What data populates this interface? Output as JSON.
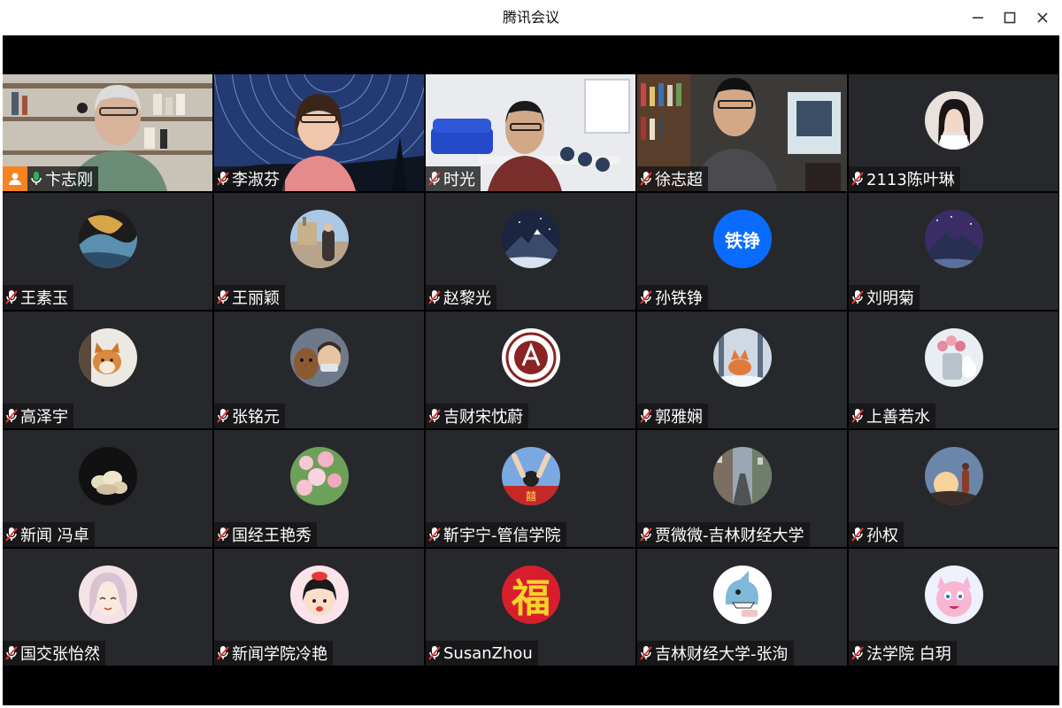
{
  "window": {
    "title": "腾讯会议",
    "controls": [
      "minimize",
      "maximize",
      "close"
    ]
  },
  "colors": {
    "speaking_border": "#2fb157",
    "host_badge": "#f6831f",
    "tile_bg": "#27282c",
    "initials_avatar": "#0a6cff"
  },
  "participants": [
    {
      "name": "卞志刚",
      "mic": "on",
      "host": true,
      "video": true,
      "speaking": true
    },
    {
      "name": "李淑芬",
      "mic": "muted",
      "video": true
    },
    {
      "name": "时光",
      "mic": "muted",
      "video": true
    },
    {
      "name": "徐志超",
      "mic": "muted",
      "video": true
    },
    {
      "name": "2113陈叶琳",
      "mic": "muted",
      "avatar": "portrait-photo"
    },
    {
      "name": "王素玉",
      "mic": "muted",
      "avatar": "art-painting"
    },
    {
      "name": "王丽颖",
      "mic": "muted",
      "avatar": "travel-photo"
    },
    {
      "name": "赵黎光",
      "mic": "muted",
      "avatar": "night-mountain"
    },
    {
      "name": "孙铁铮",
      "mic": "muted",
      "avatar_initials": "铁铮"
    },
    {
      "name": "刘明菊",
      "mic": "muted",
      "avatar": "starry-mountain"
    },
    {
      "name": "高泽宇",
      "mic": "muted",
      "avatar": "shiba-dog"
    },
    {
      "name": "张铭元",
      "mic": "muted",
      "avatar": "dog-selfie"
    },
    {
      "name": "吉财宋忱蔚",
      "mic": "muted",
      "avatar": "university-seal"
    },
    {
      "name": "郭雅娴",
      "mic": "muted",
      "avatar": "snow-fox"
    },
    {
      "name": "上善若水",
      "mic": "muted",
      "avatar": "flowers-vase"
    },
    {
      "name": "新闻 冯卓",
      "mic": "muted",
      "avatar": "sculpture"
    },
    {
      "name": "国经王艳秀",
      "mic": "muted",
      "avatar": "pink-blossoms"
    },
    {
      "name": "靳宇宁-管信学院",
      "mic": "muted",
      "avatar": "hands-up"
    },
    {
      "name": "贾微微-吉林财经大学",
      "mic": "muted",
      "avatar": "street-view"
    },
    {
      "name": "孙权",
      "mic": "muted",
      "avatar": "sunset-person"
    },
    {
      "name": "国交张怡然",
      "mic": "muted",
      "avatar": "anime-girl"
    },
    {
      "name": "新闻学院冷艳",
      "mic": "muted",
      "avatar": "cartoon-girl"
    },
    {
      "name": "SusanZhou",
      "mic": "muted",
      "avatar_glyph": "福"
    },
    {
      "name": "吉林财经大学-张洵",
      "mic": "muted",
      "avatar": "cartoon-shark"
    },
    {
      "name": "法学院 白玥",
      "mic": "muted",
      "avatar": "pink-cartoon"
    }
  ]
}
